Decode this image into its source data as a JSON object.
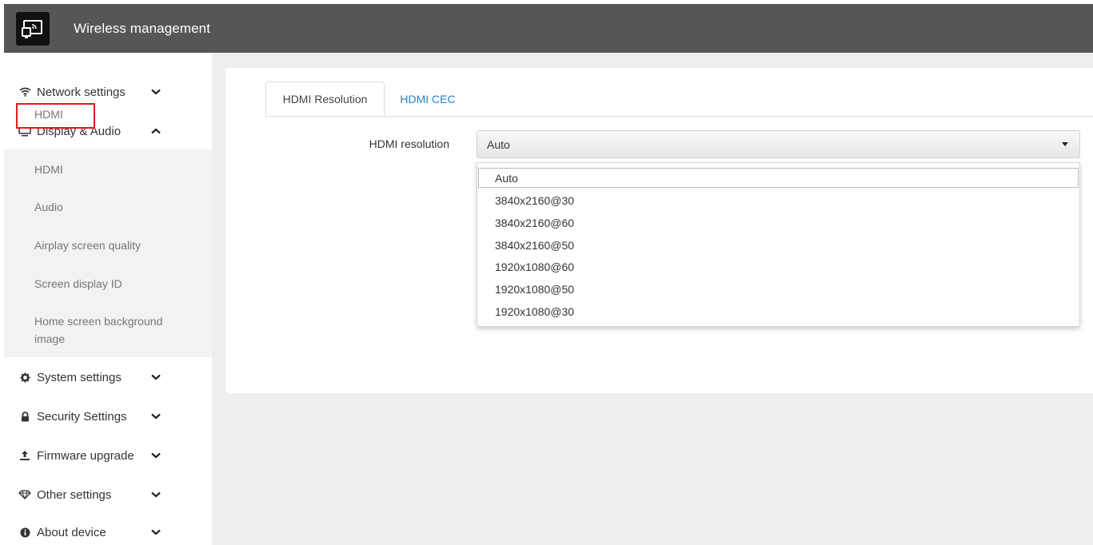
{
  "header": {
    "title": "Wireless management",
    "logo_icon": "cast-screen-icon"
  },
  "sidebar": {
    "items": [
      {
        "label": "Network settings",
        "icon": "wifi-icon",
        "chevron": "down"
      },
      {
        "label": "Display & Audio",
        "icon": "monitor-icon",
        "chevron": "up"
      },
      {
        "label": "System settings",
        "icon": "gear-icon",
        "chevron": "down"
      },
      {
        "label": "Security Settings",
        "icon": "lock-icon",
        "chevron": "down"
      },
      {
        "label": "Firmware upgrade",
        "icon": "upload-icon",
        "chevron": "down"
      },
      {
        "label": "Other settings",
        "icon": "diamond-icon",
        "chevron": "down"
      },
      {
        "label": "About device",
        "icon": "info-icon",
        "chevron": "down"
      }
    ],
    "display_sub": [
      {
        "label": "HDMI"
      },
      {
        "label": "Audio"
      },
      {
        "label": "Airplay screen quality"
      },
      {
        "label": "Screen display ID"
      },
      {
        "label": "Home screen background image"
      }
    ],
    "highlight_color": "#e11a1a"
  },
  "tabs": [
    {
      "label": "HDMI Resolution",
      "active": true
    },
    {
      "label": "HDMI CEC",
      "active": false
    }
  ],
  "form": {
    "resolution_label": "HDMI resolution",
    "resolution_value": "Auto",
    "options": [
      "Auto",
      "3840x2160@30",
      "3840x2160@60",
      "3840x2160@50",
      "1920x1080@60",
      "1920x1080@50",
      "1920x1080@30"
    ]
  },
  "colors": {
    "topbar": "#565656",
    "link": "#2a7fc0",
    "background": "#eeeeee"
  }
}
